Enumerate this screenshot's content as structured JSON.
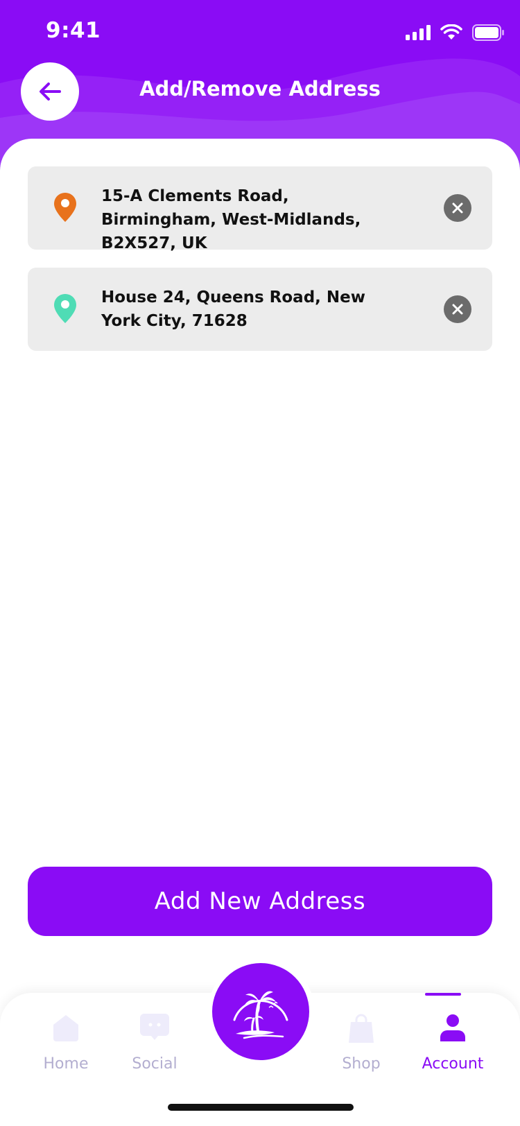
{
  "status_bar": {
    "time": "9:41"
  },
  "header": {
    "title": "Add/Remove Address"
  },
  "addresses": [
    {
      "text": "15-A Clements Road, Birmingham, West-Midlands, B2X527, UK",
      "pin_color": "#e8721c"
    },
    {
      "text": "House 24, Queens Road, New York City, 71628",
      "pin_color": "#4fdcb5"
    }
  ],
  "actions": {
    "add_label": "Add New Address"
  },
  "tabbar": {
    "tabs": [
      {
        "label": "Home",
        "icon": "home-icon",
        "active": false
      },
      {
        "label": "Social",
        "icon": "chat-icon",
        "active": false
      },
      {
        "label": "Shop",
        "icon": "shopping-bag-icon",
        "active": false
      },
      {
        "label": "Account",
        "icon": "user-icon",
        "active": true
      }
    ],
    "center_icon": "palm-tree-logo-icon"
  },
  "colors": {
    "brand": "#8a0cf5",
    "inactive_tab": "#b3aed0",
    "remove_button": "#6b6b6b"
  }
}
